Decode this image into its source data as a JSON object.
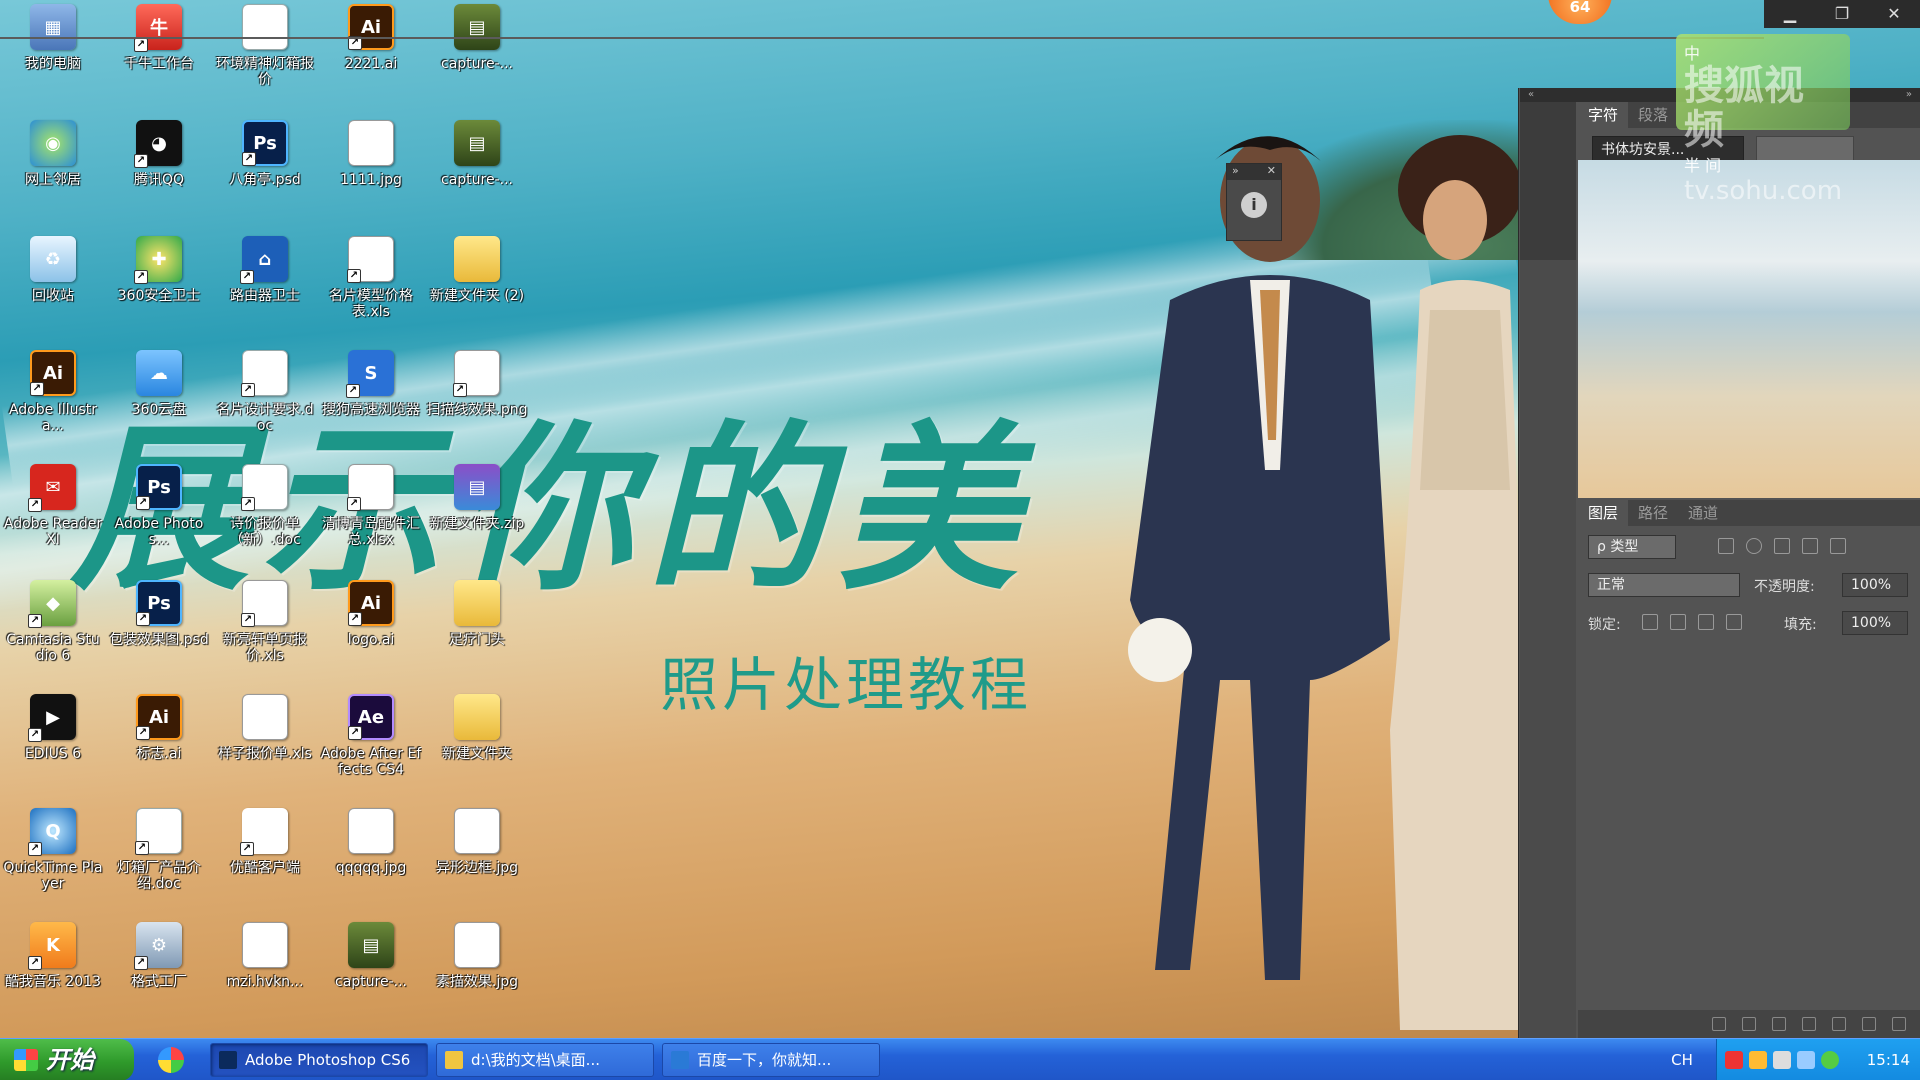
{
  "wallpaper": {
    "title_text": "展示你的美",
    "subtitle_text": "照片处理教程"
  },
  "top_badge": "64",
  "window_controls": {
    "minimize": "▁",
    "restore": "❐",
    "close": "✕"
  },
  "desktop_icons": [
    {
      "label": "我的电脑",
      "glyph": "▦"
    },
    {
      "label": "千牛工作台",
      "glyph": "牛"
    },
    {
      "label": "环境精神灯箱报价",
      "glyph": "W"
    },
    {
      "label": "2221.ai",
      "glyph": "Ai"
    },
    {
      "label": "capture-...",
      "glyph": "▤"
    },
    {
      "label": "网上邻居",
      "glyph": "◉"
    },
    {
      "label": "腾讯QQ",
      "glyph": "◕"
    },
    {
      "label": "八角亭.psd",
      "glyph": "Ps"
    },
    {
      "label": "1111.jpg",
      "glyph": "▣"
    },
    {
      "label": "capture-...",
      "glyph": "▤"
    },
    {
      "label": "回收站",
      "glyph": "♻"
    },
    {
      "label": "360安全卫士",
      "glyph": "✚"
    },
    {
      "label": "路由器卫士",
      "glyph": "⌂"
    },
    {
      "label": "名片模型价格表.xls",
      "glyph": "X"
    },
    {
      "label": "新建文件夹 (2)",
      "glyph": ""
    },
    {
      "label": "Adobe Illustra...",
      "glyph": "Ai"
    },
    {
      "label": "360云盘",
      "glyph": "☁"
    },
    {
      "label": "名片设计要求.doc",
      "glyph": "W"
    },
    {
      "label": "搜狗高速浏览器",
      "glyph": "S"
    },
    {
      "label": "扫描线效果.png",
      "glyph": "▣"
    },
    {
      "label": "Adobe Reader XI",
      "glyph": "✉"
    },
    {
      "label": "Adobe Photos...",
      "glyph": "Ps"
    },
    {
      "label": "诗价报价单（新）.doc",
      "glyph": "W"
    },
    {
      "label": "清博青岛配件汇总.xlsx",
      "glyph": "X"
    },
    {
      "label": "新建文件夹.zip",
      "glyph": "▤"
    },
    {
      "label": "Camtasia Studio 6",
      "glyph": "◆"
    },
    {
      "label": "包装效果图.psd",
      "glyph": "Ps"
    },
    {
      "label": "新亮轩单页报价.xls",
      "glyph": "X"
    },
    {
      "label": "logo.ai",
      "glyph": "Ai"
    },
    {
      "label": "足疗门头",
      "glyph": ""
    },
    {
      "label": "EDIUS 6",
      "glyph": "▶"
    },
    {
      "label": "标志.ai",
      "glyph": "Ai"
    },
    {
      "label": "样子报价单.xls",
      "glyph": "X"
    },
    {
      "label": "Adobe After Effects CS4",
      "glyph": "Ae"
    },
    {
      "label": "新建文件夹",
      "glyph": ""
    },
    {
      "label": "QuickTime Player",
      "glyph": "Q"
    },
    {
      "label": "灯箱厂产品介绍.doc",
      "glyph": "W"
    },
    {
      "label": "优酷客户端",
      "glyph": "▶"
    },
    {
      "label": "qqqqq.jpg",
      "glyph": "▣"
    },
    {
      "label": "异形边框.jpg",
      "glyph": "▣"
    },
    {
      "label": "酷我音乐 2013",
      "glyph": "K"
    },
    {
      "label": "格式工厂",
      "glyph": "⚙"
    },
    {
      "label": "mzi.hvkn...",
      "glyph": "▣"
    },
    {
      "label": "capture-...",
      "glyph": "▤"
    },
    {
      "label": "素描效果.jpg",
      "glyph": "▣"
    }
  ],
  "float_panel": {
    "collapse": "»",
    "close": "✕",
    "info": "i"
  },
  "ps": {
    "dock_arrows": {
      "left": "«",
      "right": "»"
    },
    "char_tabs": [
      "字符",
      "段落"
    ],
    "font_family": "书体坊安景...",
    "layers_tabs": [
      "图层",
      "路径",
      "通道"
    ],
    "kind_label": "ρ 类型",
    "blend_mode": "正常",
    "opacity_label": "不透明度:",
    "opacity_value": "100%",
    "lock_label": "锁定:",
    "fill_label": "填充:",
    "fill_value": "100%"
  },
  "watermark": {
    "line1": "中",
    "big": "搜狐视频",
    "line2": "半 间",
    "url": "tv.sohu.com"
  },
  "taskbar": {
    "start_label": "开始",
    "items": [
      {
        "label": "Adobe Photoshop CS6",
        "active": true
      },
      {
        "label": "d:\\我的文档\\桌面...",
        "active": false
      },
      {
        "label": "百度一下，你就知...",
        "active": false
      }
    ],
    "language": "CH",
    "clock": "15:14"
  },
  "colors": {
    "taskbar_blue": "#2462d8",
    "start_green": "#2f9a2b",
    "title_teal": "#1c9688",
    "ps_panel": "#535353"
  }
}
